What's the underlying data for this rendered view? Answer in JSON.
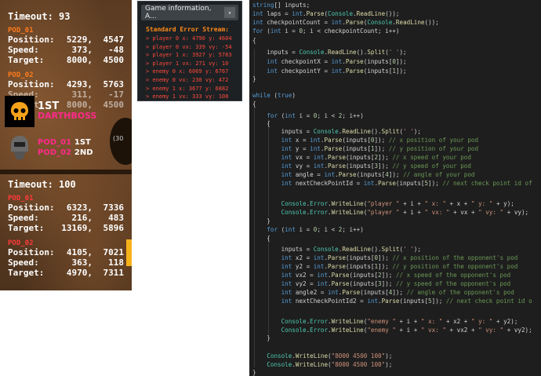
{
  "game": {
    "top": {
      "timeout_label": "Timeout:",
      "timeout_value": "93",
      "pods": [
        {
          "name": "POD_01",
          "position": [
            "5229,",
            "4547"
          ],
          "speed": [
            "373,",
            "-48"
          ],
          "target": [
            "8000,",
            "4500"
          ]
        },
        {
          "name": "POD_02",
          "position": [
            "4293,",
            "5763"
          ],
          "speed": [
            "311,",
            "-17"
          ],
          "target": [
            "8000,",
            "4500"
          ]
        }
      ]
    },
    "ranking": [
      {
        "place": "1ST",
        "name": "DARTHBOSS"
      },
      {
        "line1_pod": "POD_01",
        "line1_place": "1ST",
        "line2_pod": "POD_02",
        "line2_place": "2ND"
      }
    ],
    "wheel_label": "(30",
    "bottom": {
      "timeout_label": "Timeout:",
      "timeout_value": "100",
      "pods": [
        {
          "name": "POD_01",
          "position": [
            "6323,",
            "7336"
          ],
          "speed": [
            "216,",
            "483"
          ],
          "target": [
            "13169,",
            "5896"
          ]
        },
        {
          "name": "POD_02",
          "position": [
            "4105,",
            "7021"
          ],
          "speed": [
            "363,",
            "118"
          ],
          "target": [
            "4970,",
            "7311"
          ]
        }
      ]
    },
    "labels": {
      "position": "Position:",
      "speed": "Speed:",
      "target": "Target:"
    }
  },
  "console": {
    "dropdown_label": "Game information, A...",
    "stream_title": "Standard Error Stream:",
    "lines": [
      "> player 0 x: 4790 y: 4604",
      "> player 0 vx: 339 vy: -54",
      "> player 1 x: 3927 y: 5783",
      "> player 1 vx: 271 vy: 10",
      "> enemy 0 x: 6069 y: 6767",
      "> enemy 0 vx: 230 vy: 472",
      "> enemy 1 x: 3677 y: 6882",
      "> enemy 1 vx: 333 vy: 108"
    ]
  },
  "code": [
    "string[] inputs;",
    "int laps = int.Parse(Console.ReadLine());",
    "int checkpointCount = int.Parse(Console.ReadLine());",
    "for (int i = 0; i < checkpointCount; i++)",
    "{",
    "    inputs = Console.ReadLine().Split(' ');",
    "    int checkpointX = int.Parse(inputs[0]);",
    "    int checkpointY = int.Parse(inputs[1]);",
    "}",
    "",
    "while (true)",
    "{",
    "    for (int i = 0; i < 2; i++)",
    "    {",
    "        inputs = Console.ReadLine().Split(' ');",
    "        int x = int.Parse(inputs[0]); // x position of your pod",
    "        int y = int.Parse(inputs[1]); // y position of your pod",
    "        int vx = int.Parse(inputs[2]); // x speed of your pod",
    "        int vy = int.Parse(inputs[3]); // y speed of your pod",
    "        int angle = int.Parse(inputs[4]); // angle of your pod",
    "        int nextCheckPointId = int.Parse(inputs[5]); // next check point id of",
    "",
    "        Console.Error.WriteLine(\"player \" + i + \" x: \" + x + \" y: \" + y);",
    "        Console.Error.WriteLine(\"player \" + i + \" vx: \" + vx + \" vy: \" + vy);",
    "    }",
    "    for (int i = 0; i < 2; i++)",
    "    {",
    "        inputs = Console.ReadLine().Split(' ');",
    "        int x2 = int.Parse(inputs[0]); // x position of the opponent's pod",
    "        int y2 = int.Parse(inputs[1]); // y position of the opponent's pod",
    "        int vx2 = int.Parse(inputs[2]); // x speed of the opponent's pod",
    "        int vy2 = int.Parse(inputs[3]); // y speed of the opponent's pod",
    "        int angle2 = int.Parse(inputs[4]); // angle of the opponent's pod",
    "        int nextCheckPointId2 = int.Parse(inputs[5]); // next check point id o",
    "",
    "        Console.Error.WriteLine(\"enemy \" + i + \" x: \" + x2 + \" y: \" + y2);",
    "        Console.Error.WriteLine(\"enemy \" + i + \" vx: \" + vx2 + \" vy: \" + vy2);",
    "    }",
    "",
    "    Console.WriteLine(\"8000 4500 100\");",
    "    Console.WriteLine(\"8000 4500 100\");",
    "}"
  ]
}
